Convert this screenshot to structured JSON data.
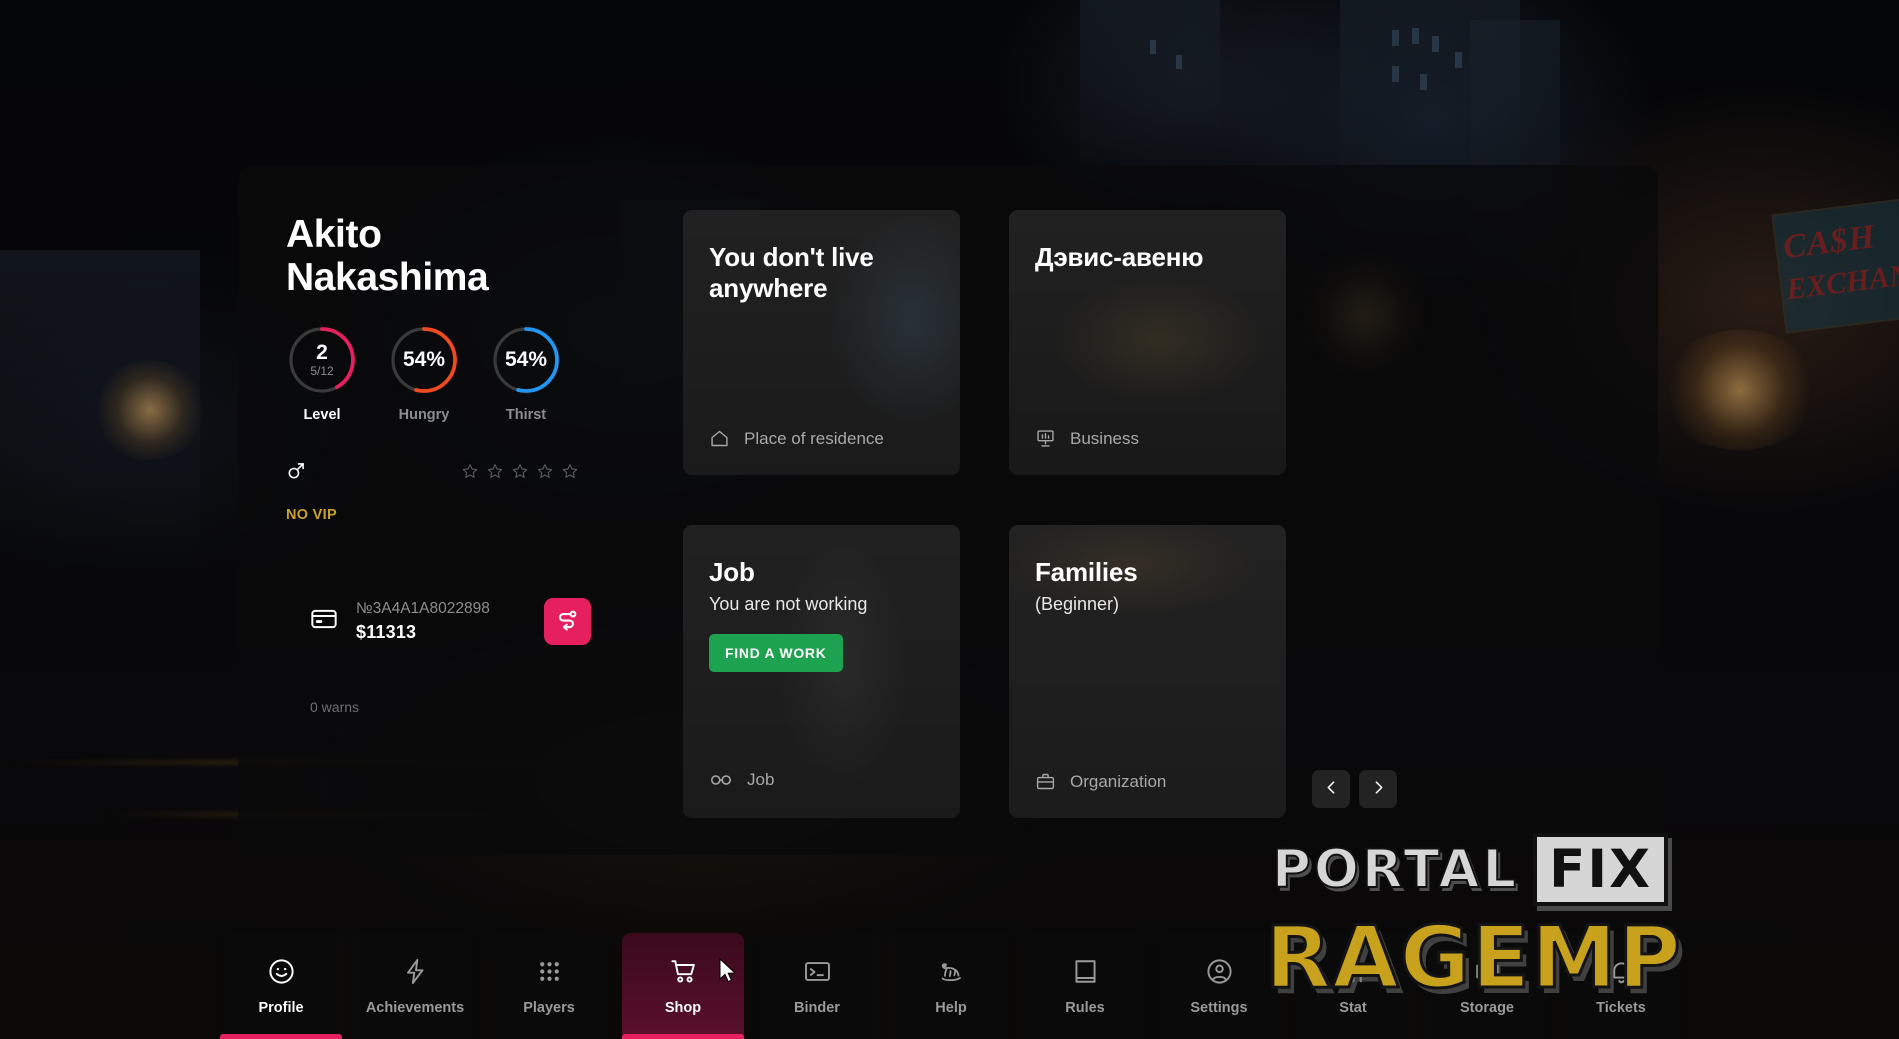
{
  "profile": {
    "name": "Akito Nakashima",
    "stats": [
      {
        "id": "level",
        "value": "2",
        "sub": "5/12",
        "label": "Level",
        "percent": 42,
        "color": "#e6205e",
        "track": "#3a3a3a"
      },
      {
        "id": "hungry",
        "value": "54%",
        "sub": "",
        "label": "Hungry",
        "percent": 54,
        "color": "#f04a22",
        "track": "#3a3a3a"
      },
      {
        "id": "thirst",
        "value": "54%",
        "sub": "",
        "label": "Thirst",
        "percent": 54,
        "color": "#2196f3",
        "track": "#3a3a3a"
      }
    ],
    "gender_icon": "male-icon",
    "stars_total": 5,
    "stars_filled": 0,
    "vip_status": "NO VIP",
    "bank": {
      "card_icon": "credit-card-icon",
      "card_number": "№3A4A1A8022898",
      "balance": "$11313",
      "transfer_icon": "money-transfer-icon"
    },
    "warns": "0 warns"
  },
  "cards": [
    {
      "id": "residence",
      "title": "You don't live anywhere",
      "subtitle": "",
      "footer_icon": "home-icon",
      "footer_label": "Place of residence",
      "button": null,
      "bg": "bg-city"
    },
    {
      "id": "business",
      "title": "Дэвис-авеню",
      "subtitle": "",
      "footer_icon": "presentation-chart-icon",
      "footer_label": "Business",
      "button": null,
      "bg": "bg-street"
    },
    {
      "id": "job",
      "title": "Job",
      "subtitle": "You are not working",
      "footer_icon": "glasses-icon",
      "footer_label": "Job",
      "button": "FIND A WORK",
      "bg": "bg-person"
    },
    {
      "id": "families",
      "title": "Families",
      "subtitle": "(Beginner)",
      "footer_icon": "briefcase-icon",
      "footer_label": "Organization",
      "button": null,
      "bg": "bg-warm"
    }
  ],
  "pager": {
    "prev_icon": "chevron-left-icon",
    "next_icon": "chevron-right-icon"
  },
  "navbar": [
    {
      "id": "profile",
      "label": "Profile",
      "icon": "smiley-face-icon",
      "state": "active"
    },
    {
      "id": "achievements",
      "label": "Achievements",
      "icon": "lightning-bolt-icon",
      "state": "normal"
    },
    {
      "id": "players",
      "label": "Players",
      "icon": "grid-dots-icon",
      "state": "normal"
    },
    {
      "id": "shop",
      "label": "Shop",
      "icon": "shopping-cart-icon",
      "state": "hover"
    },
    {
      "id": "binder",
      "label": "Binder",
      "icon": "terminal-icon",
      "state": "normal"
    },
    {
      "id": "help",
      "label": "Help",
      "icon": "rocking-horse-icon",
      "state": "normal"
    },
    {
      "id": "rules",
      "label": "Rules",
      "icon": "book-icon",
      "state": "normal"
    },
    {
      "id": "settings",
      "label": "Settings",
      "icon": "user-circle-icon",
      "state": "normal"
    },
    {
      "id": "stat",
      "label": "Stat",
      "icon": "bar-chart-icon",
      "state": "normal"
    },
    {
      "id": "storage",
      "label": "Storage",
      "icon": "box-icon",
      "state": "normal"
    },
    {
      "id": "tickets",
      "label": "Tickets",
      "icon": "bell-icon",
      "state": "normal"
    }
  ],
  "watermark": {
    "portal": "PORTAL",
    "fix": "FIX",
    "ragemp": "RAGEMP"
  },
  "background_sign": {
    "line1": "CA$H",
    "line2": "EXCHANGE"
  },
  "colors": {
    "accent_pink": "#e6205e",
    "green": "#1da34f",
    "orange": "#f04a22",
    "blue": "#2196f3",
    "vip_gold": "#c8a22a",
    "ragemp_gold": "#c8a21c"
  }
}
